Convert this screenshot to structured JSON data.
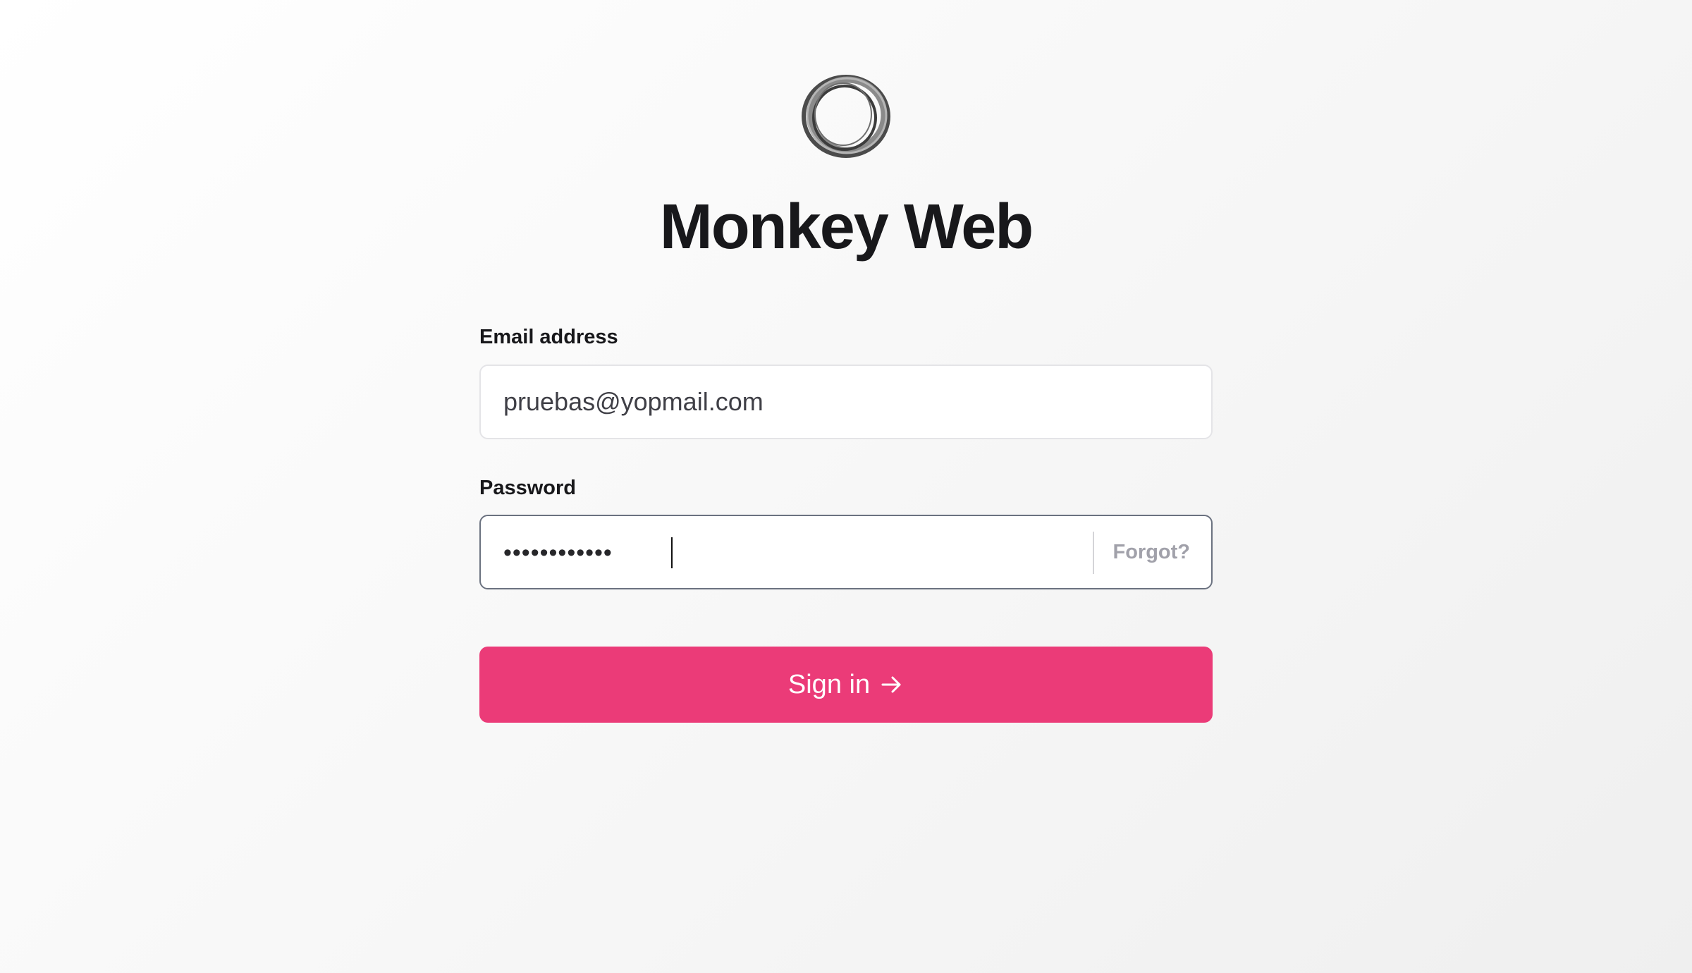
{
  "app": {
    "title": "Monkey Web"
  },
  "logo": {
    "icon": "ring-logo-icon"
  },
  "form": {
    "email": {
      "label": "Email address",
      "value": "pruebas@yopmail.com"
    },
    "password": {
      "label": "Password",
      "masked_value": "••••••••••••",
      "forgot_label": "Forgot?"
    },
    "submit": {
      "label": "Sign in",
      "icon": "arrow-right-icon"
    }
  },
  "colors": {
    "accent": "#eb3b78",
    "text": "#18181b",
    "muted": "#a1a1aa"
  }
}
